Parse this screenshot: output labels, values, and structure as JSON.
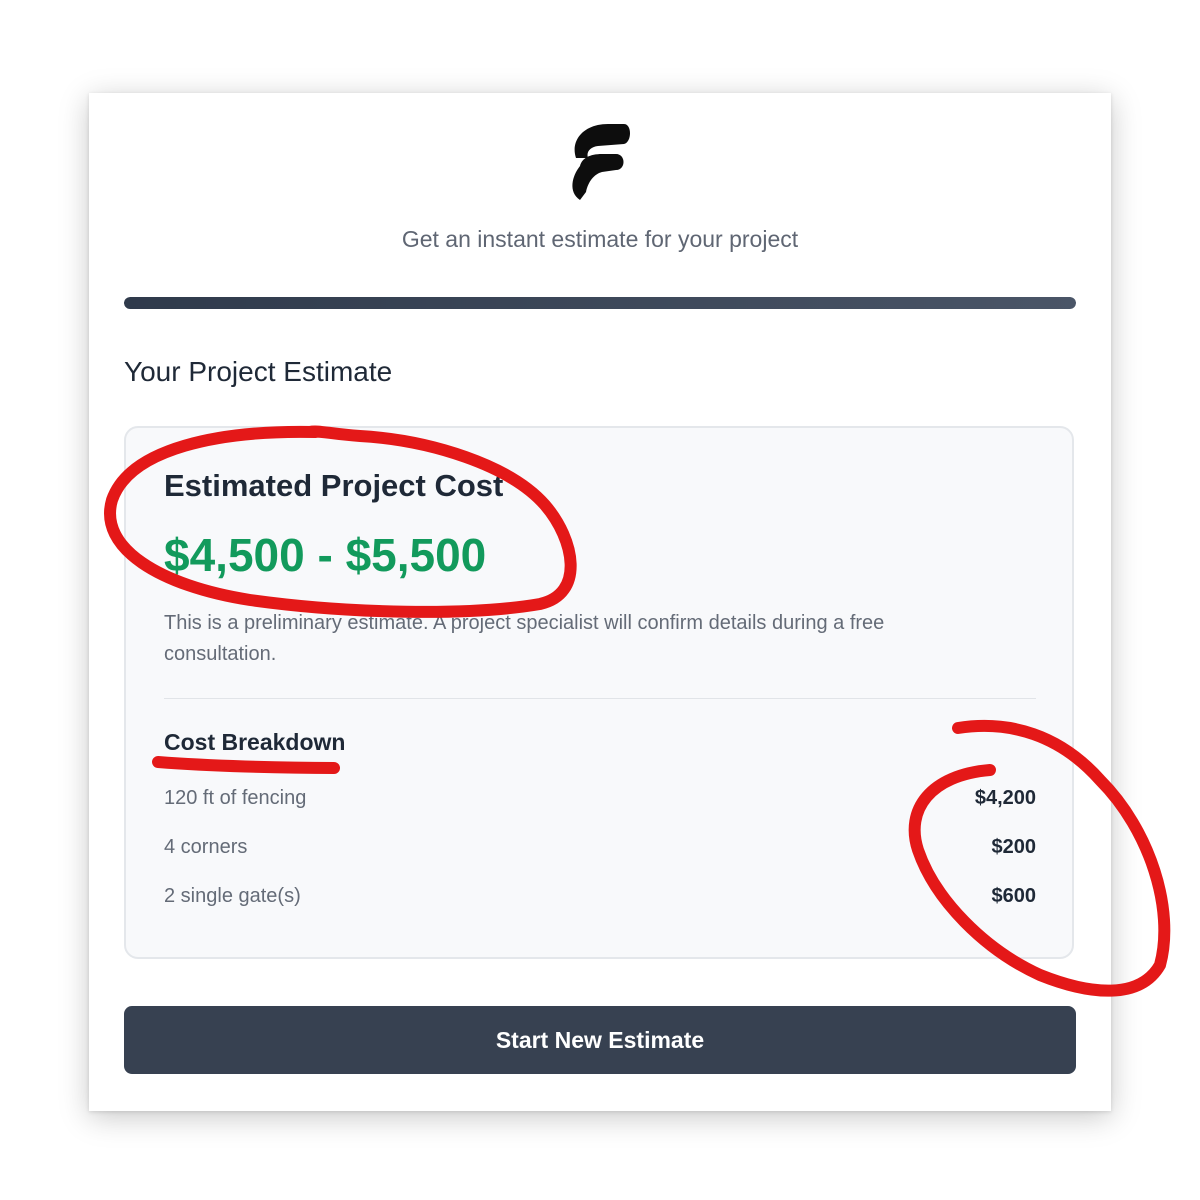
{
  "header": {
    "logo_icon": "stylized-f-logo-icon",
    "tagline": "Get an instant estimate for your project"
  },
  "progress": {
    "value_percent": 100
  },
  "estimate": {
    "section_title": "Your Project Estimate",
    "cost_label": "Estimated Project Cost",
    "cost_range": "$4,500 - $5,500",
    "disclaimer": "This is a preliminary estimate. A project specialist will confirm details during a free consultation."
  },
  "breakdown": {
    "title": "Cost Breakdown",
    "items": [
      {
        "label": "120 ft of fencing",
        "value": "$4,200"
      },
      {
        "label": "4 corners",
        "value": "$200"
      },
      {
        "label": "2 single gate(s)",
        "value": "$600"
      }
    ]
  },
  "actions": {
    "start_new_label": "Start New Estimate"
  },
  "colors": {
    "accent_green": "#129a5c",
    "button_dark": "#374151",
    "annotation_red": "#e41818"
  }
}
